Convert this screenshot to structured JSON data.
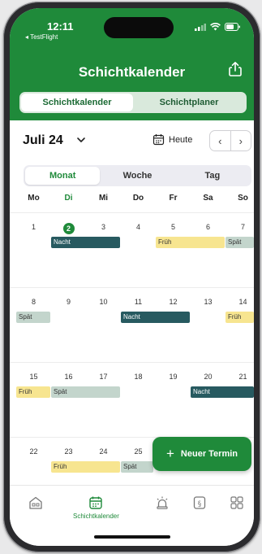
{
  "status_bar": {
    "time": "12:11",
    "back_app": "◂ TestFlight"
  },
  "header": {
    "title": "Schichtkalender",
    "share_icon": "share-icon"
  },
  "top_segment": {
    "items": [
      "Schichtkalender",
      "Schichtplaner"
    ],
    "selected": "Schichtkalender"
  },
  "month_nav": {
    "month": "Juli 24",
    "today_label": "Heute",
    "prev": "‹",
    "next": "›"
  },
  "view_segment": {
    "items": [
      "Monat",
      "Woche",
      "Tag"
    ],
    "selected": "Monat"
  },
  "weekdays": [
    "Mo",
    "Di",
    "Mi",
    "Do",
    "Fr",
    "Sa",
    "So"
  ],
  "weeks": [
    {
      "days": [
        "1",
        "2",
        "3",
        "4",
        "5",
        "6",
        "7"
      ],
      "shifts": [
        {
          "label": "Nacht",
          "type": "nacht"
        },
        {
          "label": "Früh",
          "type": "frueh"
        },
        {
          "label": "Spät",
          "type": "spaet"
        }
      ]
    },
    {
      "days": [
        "8",
        "9",
        "10",
        "11",
        "12",
        "13",
        "14"
      ],
      "shifts": [
        {
          "label": "Spät",
          "type": "spaet"
        },
        {
          "label": "Nacht",
          "type": "nacht"
        },
        {
          "label": "Früh",
          "type": "frueh"
        }
      ]
    },
    {
      "days": [
        "15",
        "16",
        "17",
        "18",
        "19",
        "20",
        "21"
      ],
      "shifts": [
        {
          "label": "Früh",
          "type": "frueh"
        },
        {
          "label": "Spät",
          "type": "spaet"
        },
        {
          "label": "Nacht",
          "type": "nacht"
        }
      ]
    },
    {
      "days": [
        "22",
        "23",
        "24",
        "25"
      ],
      "shifts": [
        {
          "label": "Früh",
          "type": "frueh"
        },
        {
          "label": "Spät",
          "type": "spaet"
        }
      ]
    }
  ],
  "today": "2",
  "fab": {
    "label": "Neuer Termin",
    "icon": "plus-icon"
  },
  "tabbar": {
    "items": [
      {
        "icon": "home-icon",
        "label": ""
      },
      {
        "icon": "calendar-icon",
        "label": "Schichtkalender",
        "selected": true
      },
      {
        "icon": "alarm-light-icon",
        "label": ""
      },
      {
        "icon": "paragraph-icon",
        "label": ""
      },
      {
        "icon": "grid-icon",
        "label": ""
      }
    ]
  },
  "colors": {
    "accent": "#1f8a3a",
    "nacht": "#275a60",
    "frueh": "#f7e590",
    "spaet": "#c3d5cc"
  }
}
